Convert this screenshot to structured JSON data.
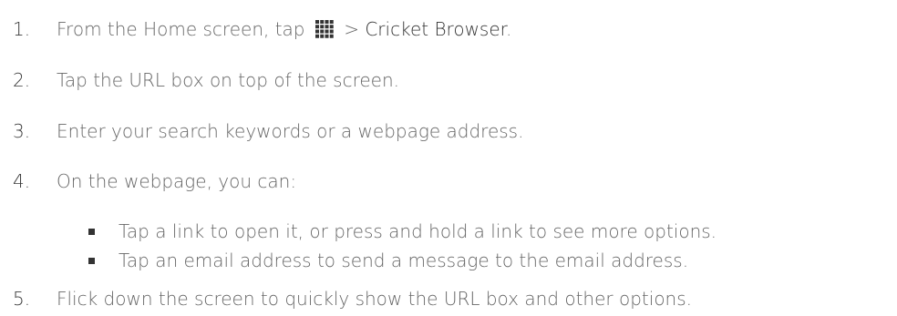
{
  "steps": [
    {
      "num": "1.",
      "text_before": "From the Home screen, tap",
      "icon": "apps-grid-icon",
      "text_mid": " > ",
      "emph": "Cricket Browser",
      "text_after": "."
    },
    {
      "num": "2.",
      "text": "Tap the URL box on top of the screen."
    },
    {
      "num": "3.",
      "text": "Enter your search keywords or a webpage address."
    },
    {
      "num": "4.",
      "text": "On the webpage, you can:",
      "bullets": [
        "Tap a link to open it, or press and hold a link to see more options.",
        "Tap an email address to send a message to the email address."
      ]
    },
    {
      "num": "5.",
      "text": "Flick down the screen to quickly show the URL box and other options."
    }
  ]
}
